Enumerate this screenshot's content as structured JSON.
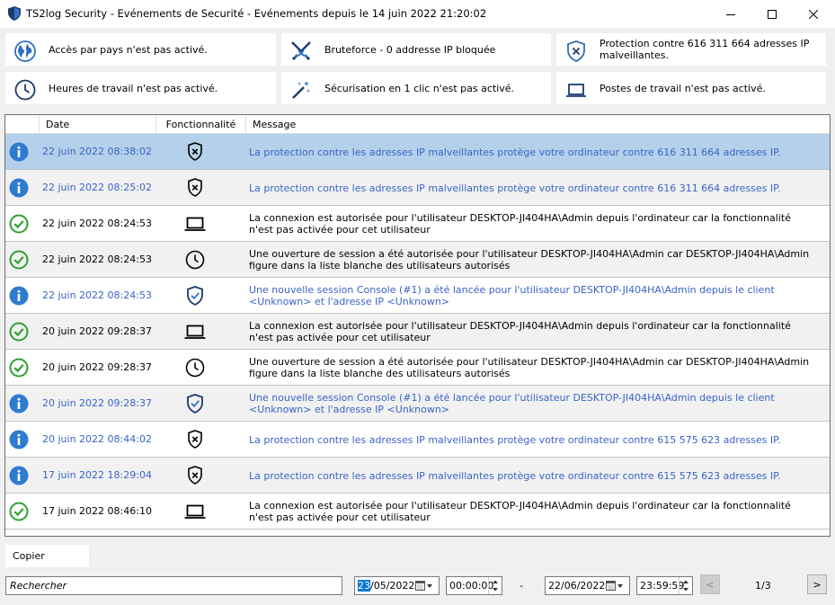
{
  "window": {
    "title": "TS2log Security - Evénements de Securité - Evénements depuis le 14 juin 2022 21:20:02"
  },
  "cards": [
    {
      "icon": "globe-icon",
      "text": "Accès par pays n'est pas activé."
    },
    {
      "icon": "crossed-swords-icon",
      "text": "Bruteforce - 0 addresse IP bloquée"
    },
    {
      "icon": "shield-x-icon",
      "text": "Protection contre 616 311 664 adresses IP malveillantes."
    },
    {
      "icon": "clock-icon",
      "text": "Heures de travail n'est pas activé."
    },
    {
      "icon": "magic-wand-icon",
      "text": "Sécurisation en 1 clic n'est pas activé."
    },
    {
      "icon": "laptop-icon",
      "text": "Postes de travail n'est pas activé."
    }
  ],
  "grid": {
    "columns": {
      "date": "Date",
      "feature": "Fonctionnalité",
      "message": "Message"
    },
    "rows": [
      {
        "status": "info",
        "date": "22 juin 2022 08:38:02",
        "feature": "shield-x",
        "message": "La protection contre les adresses IP malveillantes protège votre ordinateur contre 616 311 664 adresses IP.",
        "selected": true
      },
      {
        "status": "info",
        "date": "22 juin 2022 08:25:02",
        "feature": "shield-x",
        "message": "La protection contre les adresses IP malveillantes protège votre ordinateur contre 616 311 664 adresses IP."
      },
      {
        "status": "ok",
        "date": "22 juin 2022 08:24:53",
        "feature": "laptop",
        "message": "La connexion est autorisée pour l'utilisateur DESKTOP-JI404HA\\Admin depuis l'ordinateur  car la fonctionnalité n'est pas activée pour cet utilisateur"
      },
      {
        "status": "ok",
        "date": "22 juin 2022 08:24:53",
        "feature": "clock",
        "message": "Une ouverture de session a été autorisée pour l'utilisateur DESKTOP-JI404HA\\Admin car DESKTOP-JI404HA\\Admin figure dans la liste blanche des utilisateurs autorisés"
      },
      {
        "status": "info",
        "date": "22 juin 2022 08:24:53",
        "feature": "shield-check",
        "message": "Une nouvelle session Console (#1) a été lancée pour l'utilisateur DESKTOP-JI404HA\\Admin depuis le client <Unknown> et l'adresse IP <Unknown>"
      },
      {
        "status": "ok",
        "date": "20 juin 2022 09:28:37",
        "feature": "laptop",
        "message": "La connexion est autorisée pour l'utilisateur DESKTOP-JI404HA\\Admin depuis l'ordinateur  car la fonctionnalité n'est pas activée pour cet utilisateur"
      },
      {
        "status": "ok",
        "date": "20 juin 2022 09:28:37",
        "feature": "clock",
        "message": "Une ouverture de session a été autorisée pour l'utilisateur DESKTOP-JI404HA\\Admin car DESKTOP-JI404HA\\Admin figure dans la liste blanche des utilisateurs autorisés"
      },
      {
        "status": "info",
        "date": "20 juin 2022 09:28:37",
        "feature": "shield-check",
        "message": "Une nouvelle session Console (#1) a été lancée pour l'utilisateur DESKTOP-JI404HA\\Admin depuis le client <Unknown> et l'adresse IP <Unknown>"
      },
      {
        "status": "info",
        "date": "20 juin 2022 08:44:02",
        "feature": "shield-x",
        "message": "La protection contre les adresses IP malveillantes protège votre ordinateur contre 615 575 623 adresses IP."
      },
      {
        "status": "info",
        "date": "17 juin 2022 18:29:04",
        "feature": "shield-x",
        "message": "La protection contre les adresses IP malveillantes protège votre ordinateur contre 615 575 623 adresses IP."
      },
      {
        "status": "ok",
        "date": "17 juin 2022 08:46:10",
        "feature": "laptop",
        "message": "La connexion est autorisée pour l'utilisateur DESKTOP-JI404HA\\Admin depuis l'ordinateur  car la fonctionnalité n'est pas activée pour cet utilisateur"
      }
    ]
  },
  "footer": {
    "copy_label": "Copier",
    "search_placeholder": "Rechercher",
    "start_day": "23",
    "start_date_rest": "/05/2022",
    "start_time": "00:00:00",
    "separator": "-",
    "end_date": "22/06/2022",
    "end_time": "23:59:59",
    "prev": "<",
    "next": ">",
    "page": "1/3"
  },
  "colors": {
    "accent": "#0078d7",
    "info_blue": "#2f7bd1",
    "ok_green": "#30a030",
    "link_text": "#3a64c6",
    "selected_row": "#b5d0ea"
  }
}
